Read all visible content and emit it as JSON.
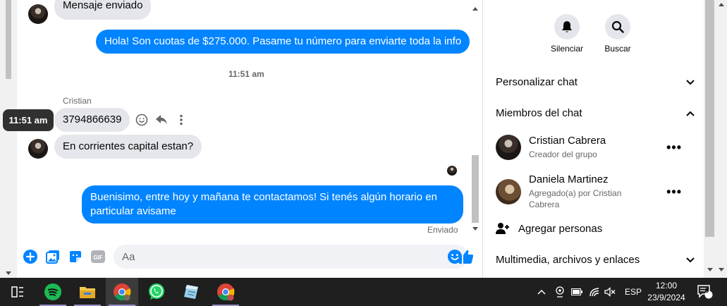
{
  "messages": {
    "msg0_text": "Mensaje enviado",
    "msg1_text": "Hola! Son cuotas de $275.000. Pasame tu número para enviarte toda la info",
    "time_separator": "11:51 am",
    "sender_name": "Cristian",
    "msg2_text": "3794866639",
    "msg3_text": "En corrientes capital estan?",
    "msg4_text": "Buenisimo, entre hoy y mañana te contactamos! Si tenés algún horario en particular avisame",
    "status": "Enviado",
    "tooltip": "11:51 am"
  },
  "composer": {
    "placeholder": "Aa"
  },
  "panel": {
    "mute_label": "Silenciar",
    "search_label": "Buscar",
    "customize_label": "Personalizar chat",
    "members_label": "Miembros del chat",
    "members": [
      {
        "name": "Cristian Cabrera",
        "sub": "Creador del grupo"
      },
      {
        "name": "Daniela Martinez",
        "sub": "Agregado(a) por Cristian Cabrera"
      }
    ],
    "add_people_label": "Agregar personas",
    "media_label": "Multimedia, archivos y enlaces"
  },
  "taskbar": {
    "lang": "ESP",
    "time": "12:00",
    "date": "23/9/2024",
    "notif_count": "3"
  },
  "colors": {
    "accent": "#0084ff",
    "incoming_bubble": "#e4e6eb",
    "taskbar": "#1f1f1f"
  }
}
